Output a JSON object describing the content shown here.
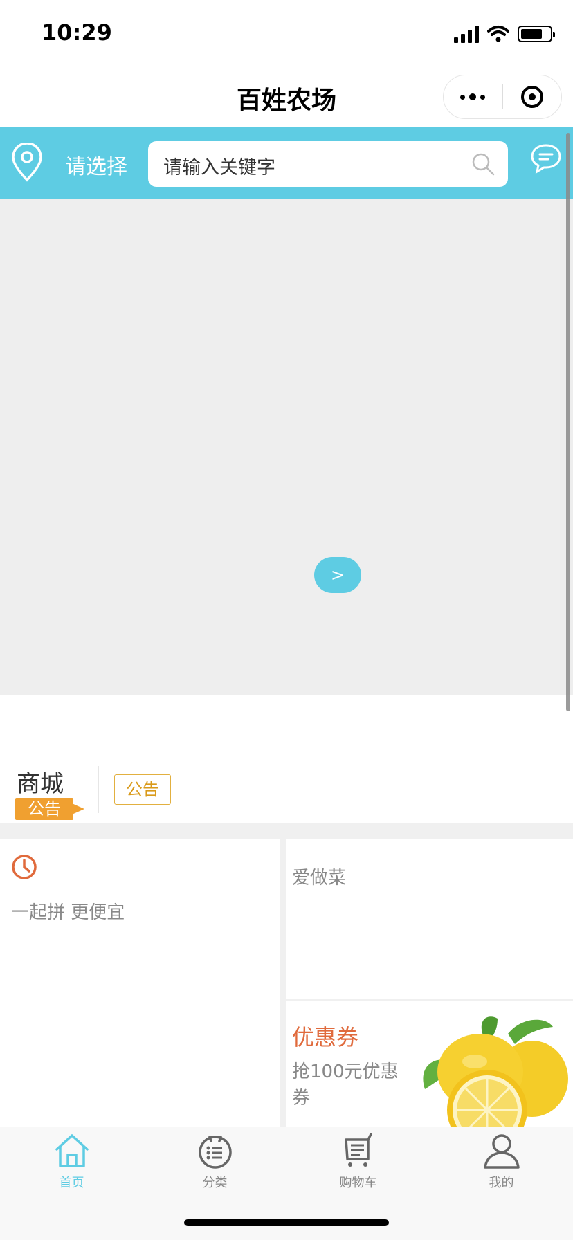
{
  "status_bar": {
    "time": "10:29"
  },
  "nav": {
    "title": "百姓农场"
  },
  "search_header": {
    "location_label": "请选择",
    "search_placeholder": "请输入关键字"
  },
  "banner": {
    "next_label": ">"
  },
  "notice": {
    "logo_title": "商城",
    "logo_tag": "公告",
    "badge": "公告"
  },
  "grid": {
    "group_buy_subtitle": "一起拼 更便宜",
    "recipe_title": "爱做菜",
    "coupon_title": "优惠券",
    "coupon_subtitle": "抢100元优惠券"
  },
  "tab_bar": {
    "items": [
      {
        "label": "首页",
        "icon": "home-icon",
        "active": true
      },
      {
        "label": "分类",
        "icon": "category-icon",
        "active": false
      },
      {
        "label": "购物车",
        "icon": "cart-icon",
        "active": false
      },
      {
        "label": "我的",
        "icon": "profile-icon",
        "active": false
      }
    ]
  },
  "colors": {
    "accent": "#5ecce3",
    "notice_orange": "#f0a030",
    "coupon_red": "#e06a3c"
  }
}
